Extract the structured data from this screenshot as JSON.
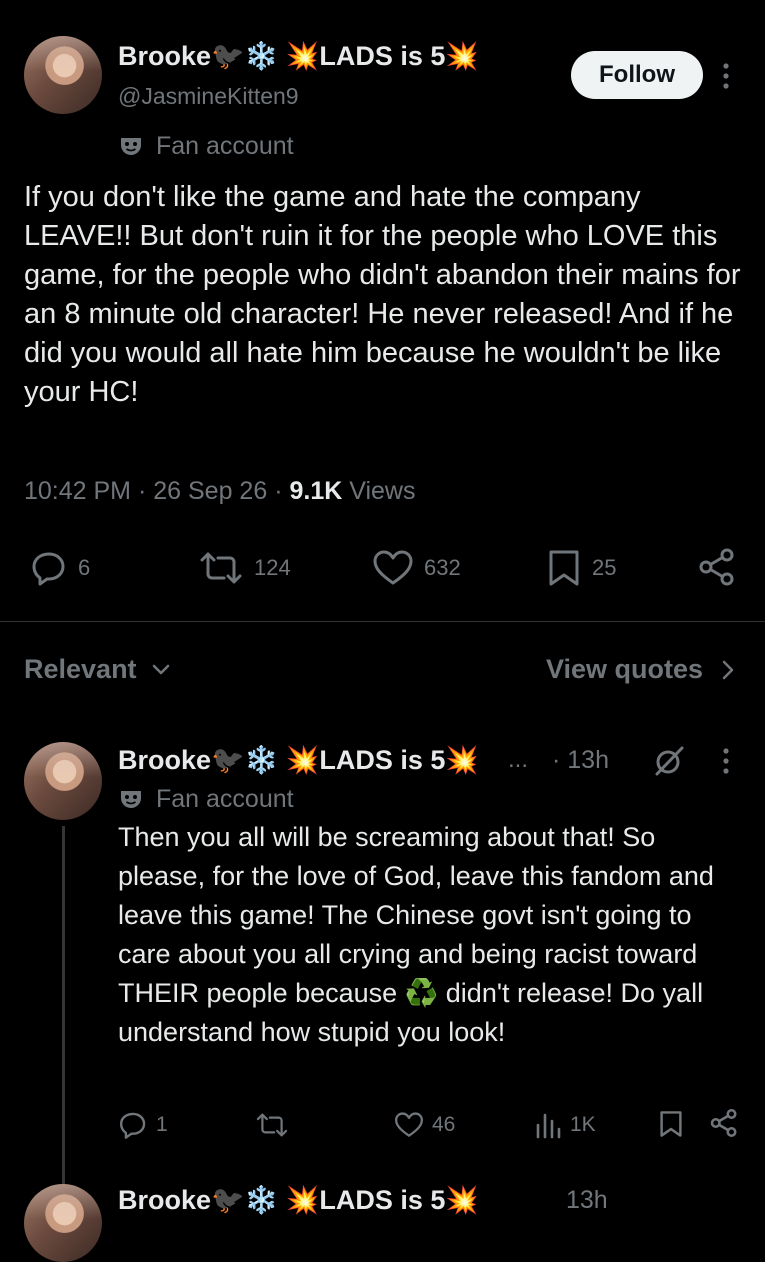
{
  "tweet": {
    "author_name": "Brooke🐦‍⬛❄️ 💥LADS is 5💥",
    "handle": "@JasmineKitten9",
    "follow_label": "Follow",
    "label": "Fan account",
    "body": "If you don't like the game and hate the company LEAVE!! But don't ruin it for the people who LOVE this game, for the people who didn't abandon their mains for an 8 minute old character! He never released! And if he did you would all hate him because he wouldn't be like your HC!",
    "time": "10:42 PM",
    "date": "26 Sep 26",
    "views_count": "9.1K",
    "views_label": "Views",
    "replies": "6",
    "reposts": "124",
    "likes": "632",
    "bookmarks": "25"
  },
  "sort": {
    "relevant_label": "Relevant",
    "view_quotes_label": "View quotes"
  },
  "reply": {
    "author_name": "Brooke🐦‍⬛❄️ 💥LADS is 5💥",
    "ellipsis": "...",
    "time": "· 13h",
    "label": "Fan account",
    "body": "Then you all will be screaming about that! So please, for the love of God, leave this fandom and leave this game! The Chinese govt isn't going to care about you all crying and being racist toward THEIR people because ♻️ didn't release! Do yall understand how stupid you look!",
    "replies": "1",
    "likes": "46",
    "views": "1K"
  },
  "next_reply": {
    "author_name": "Brooke🐦‍⬛❄️ 💥LADS is 5💥",
    "time": "13h"
  }
}
